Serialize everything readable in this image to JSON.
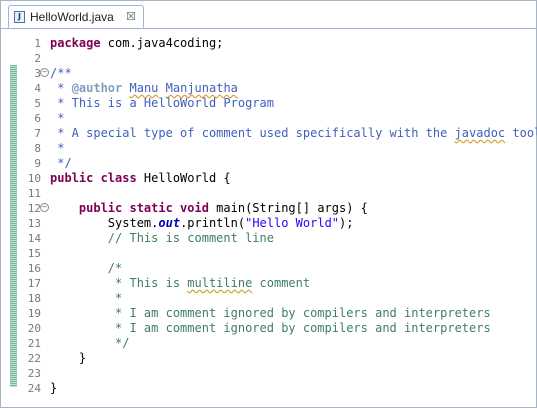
{
  "tab": {
    "title": "HelloWorld.java",
    "icon": "J",
    "close": "☒"
  },
  "lines": [
    {
      "n": "1",
      "fold": false,
      "tokens": [
        {
          "t": "kw",
          "v": "package"
        },
        {
          "t": "p",
          "v": " com.java4coding;"
        }
      ]
    },
    {
      "n": "2",
      "fold": false,
      "tokens": []
    },
    {
      "n": "3",
      "fold": true,
      "tokens": [
        {
          "t": "jd",
          "v": "/**"
        }
      ]
    },
    {
      "n": "4",
      "fold": false,
      "tokens": [
        {
          "t": "jd",
          "v": " * "
        },
        {
          "t": "tag",
          "v": "@author"
        },
        {
          "t": "jd",
          "v": " "
        },
        {
          "t": "jdsq",
          "v": "Manu"
        },
        {
          "t": "jd",
          "v": " "
        },
        {
          "t": "jdsq",
          "v": "Manjunatha"
        }
      ]
    },
    {
      "n": "5",
      "fold": false,
      "tokens": [
        {
          "t": "jd",
          "v": " * This is a HelloWorld Program"
        }
      ]
    },
    {
      "n": "6",
      "fold": false,
      "tokens": [
        {
          "t": "jd",
          "v": " *"
        }
      ]
    },
    {
      "n": "7",
      "fold": false,
      "tokens": [
        {
          "t": "jd",
          "v": " * A special type of comment used specifically with the "
        },
        {
          "t": "jdsq",
          "v": "javadoc"
        },
        {
          "t": "jd",
          "v": " tool"
        }
      ]
    },
    {
      "n": "8",
      "fold": false,
      "tokens": [
        {
          "t": "jd",
          "v": " *"
        }
      ]
    },
    {
      "n": "9",
      "fold": false,
      "tokens": [
        {
          "t": "jd",
          "v": " */"
        }
      ]
    },
    {
      "n": "10",
      "fold": false,
      "tokens": [
        {
          "t": "kw",
          "v": "public class"
        },
        {
          "t": "p",
          "v": " HelloWorld {"
        }
      ]
    },
    {
      "n": "11",
      "fold": false,
      "tokens": []
    },
    {
      "n": "12",
      "fold": true,
      "tokens": [
        {
          "t": "p",
          "v": "    "
        },
        {
          "t": "kw",
          "v": "public static void"
        },
        {
          "t": "p",
          "v": " main(String[] args) {"
        }
      ]
    },
    {
      "n": "13",
      "fold": false,
      "tokens": [
        {
          "t": "p",
          "v": "        System."
        },
        {
          "t": "it",
          "v": "out"
        },
        {
          "t": "p",
          "v": ".println("
        },
        {
          "t": "str",
          "v": "\"Hello World\""
        },
        {
          "t": "p",
          "v": ");"
        }
      ]
    },
    {
      "n": "14",
      "fold": false,
      "tokens": [
        {
          "t": "p",
          "v": "        "
        },
        {
          "t": "cm",
          "v": "// This is comment line"
        }
      ]
    },
    {
      "n": "15",
      "fold": false,
      "tokens": []
    },
    {
      "n": "16",
      "fold": false,
      "tokens": [
        {
          "t": "p",
          "v": "        "
        },
        {
          "t": "cm",
          "v": "/*"
        }
      ]
    },
    {
      "n": "17",
      "fold": false,
      "tokens": [
        {
          "t": "p",
          "v": "        "
        },
        {
          "t": "cm",
          "v": " * This is "
        },
        {
          "t": "cmsq",
          "v": "multiline"
        },
        {
          "t": "cm",
          "v": " comment"
        }
      ]
    },
    {
      "n": "18",
      "fold": false,
      "tokens": [
        {
          "t": "p",
          "v": "        "
        },
        {
          "t": "cm",
          "v": " *"
        }
      ]
    },
    {
      "n": "19",
      "fold": false,
      "tokens": [
        {
          "t": "p",
          "v": "        "
        },
        {
          "t": "cm",
          "v": " * I am comment ignored by compilers and interpreters"
        }
      ]
    },
    {
      "n": "20",
      "fold": false,
      "tokens": [
        {
          "t": "p",
          "v": "        "
        },
        {
          "t": "cm",
          "v": " * I am comment ignored by compilers and interpreters"
        }
      ]
    },
    {
      "n": "21",
      "fold": false,
      "tokens": [
        {
          "t": "p",
          "v": "        "
        },
        {
          "t": "cm",
          "v": " */"
        }
      ]
    },
    {
      "n": "22",
      "fold": false,
      "tokens": [
        {
          "t": "p",
          "v": "    }"
        }
      ]
    },
    {
      "n": "23",
      "fold": false,
      "tokens": []
    },
    {
      "n": "24",
      "fold": false,
      "tokens": [
        {
          "t": "p",
          "v": "}"
        }
      ]
    }
  ],
  "colors": {
    "keyword": "#7f0055",
    "javadoc": "#3f5fbf",
    "comment": "#3f7f5f",
    "string": "#2a00ff",
    "field": "#0000c0"
  }
}
